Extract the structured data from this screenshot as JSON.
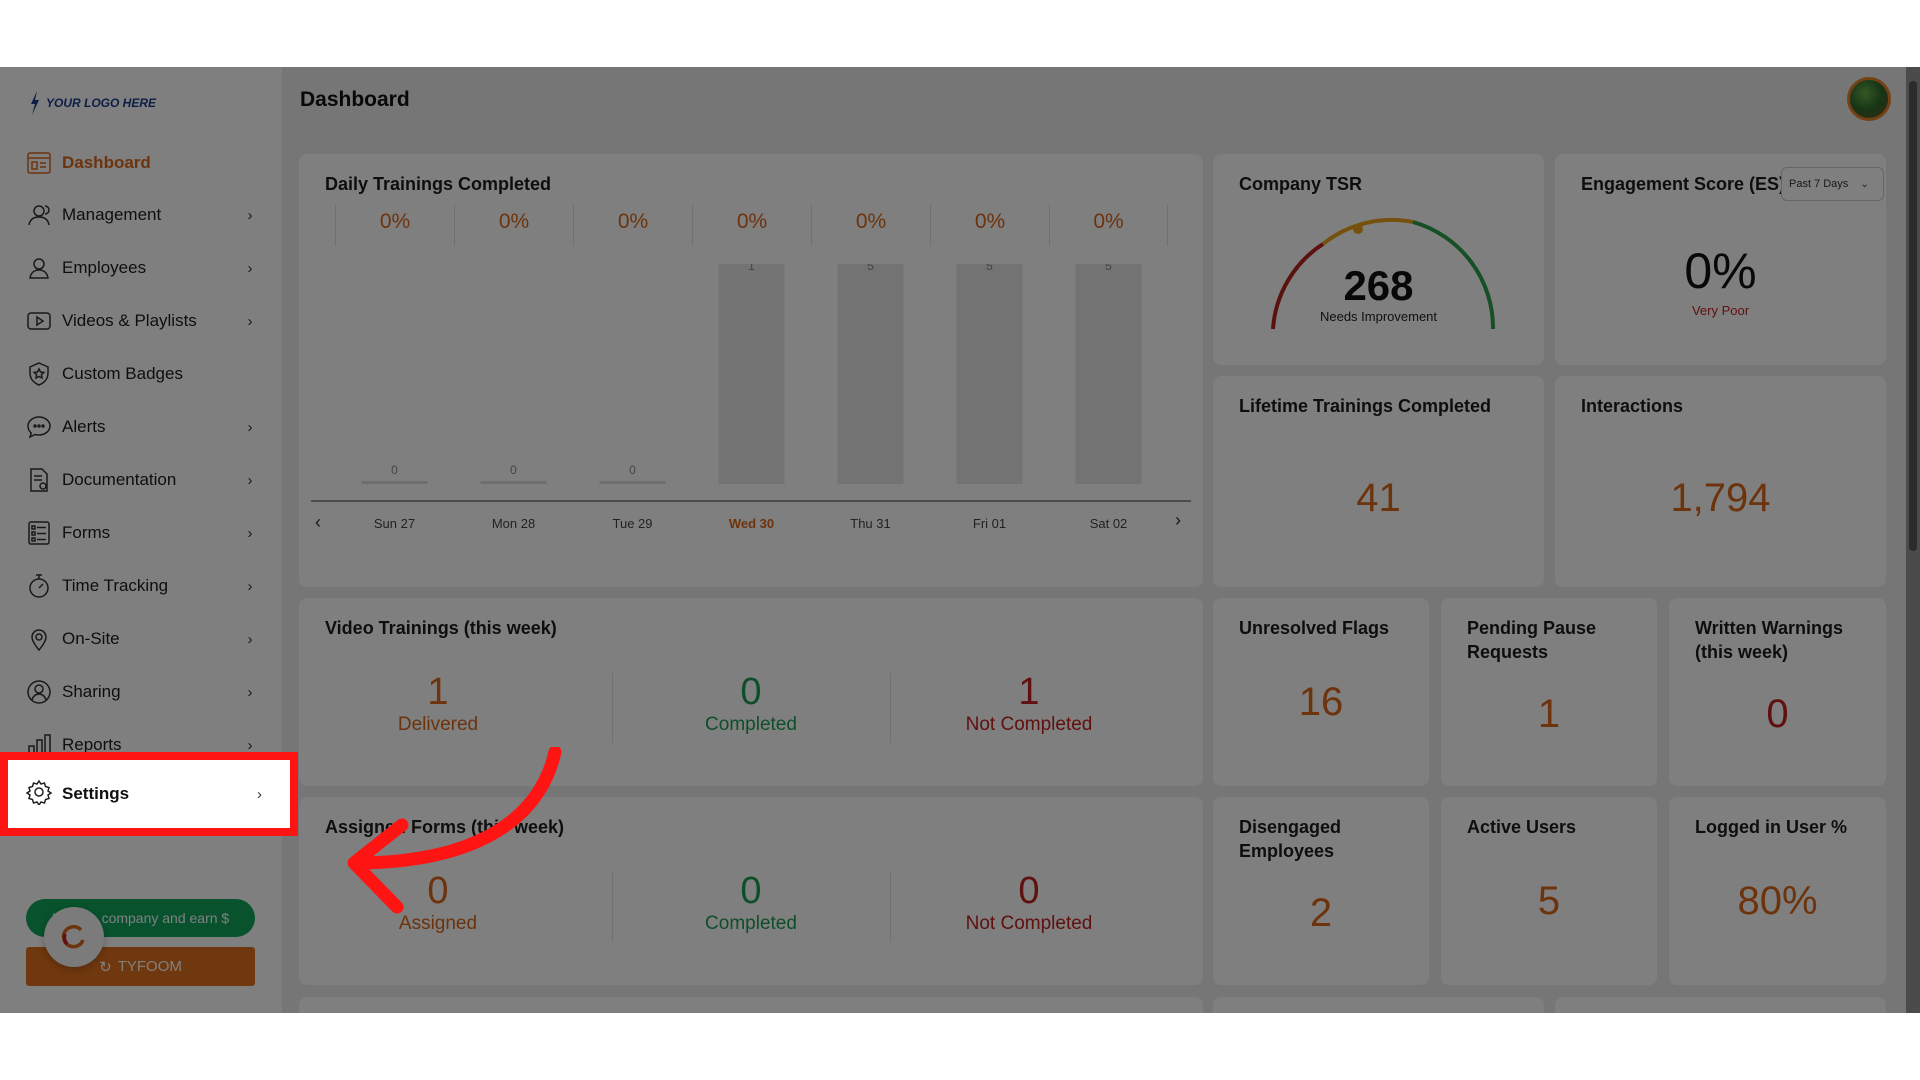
{
  "logo": {
    "text": "YOUR LOGO HERE"
  },
  "header": {
    "title": "Dashboard"
  },
  "sidebar": {
    "items": [
      {
        "label": "Dashboard",
        "icon": "dashboard-icon"
      },
      {
        "label": "Management",
        "icon": "users-icon"
      },
      {
        "label": "Employees",
        "icon": "user-icon"
      },
      {
        "label": "Videos & Playlists",
        "icon": "video-icon"
      },
      {
        "label": "Custom Badges",
        "icon": "badge-icon"
      },
      {
        "label": "Alerts",
        "icon": "chat-icon"
      },
      {
        "label": "Documentation",
        "icon": "document-icon"
      },
      {
        "label": "Forms",
        "icon": "list-icon"
      },
      {
        "label": "Time Tracking",
        "icon": "stopwatch-icon"
      },
      {
        "label": "On-Site",
        "icon": "location-icon"
      },
      {
        "label": "Sharing",
        "icon": "share-icon"
      },
      {
        "label": "Reports",
        "icon": "chart-icon"
      },
      {
        "label": "Settings",
        "icon": "gear-icon"
      }
    ],
    "refer_label": "Refer a company and earn $",
    "tyfoom_label": "TYFOOM"
  },
  "daily": {
    "title": "Daily Trainings Completed",
    "percents": [
      "0%",
      "0%",
      "0%",
      "0%",
      "0%",
      "0%",
      "0%"
    ],
    "days": [
      "Sun 27",
      "Mon 28",
      "Tue 29",
      "Wed 30",
      "Thu 31",
      "Fri 01",
      "Sat 02"
    ],
    "highlight_day": "Wed 30"
  },
  "chart_data": {
    "type": "bar",
    "title": "Daily Trainings Completed",
    "categories": [
      "Sun 27",
      "Mon 28",
      "Tue 29",
      "Wed 30",
      "Thu 31",
      "Fri 01",
      "Sat 02"
    ],
    "values": [
      0,
      0,
      0,
      1,
      5,
      5,
      5
    ],
    "ylim": [
      0,
      5
    ]
  },
  "tsr": {
    "title": "Company TSR",
    "value": "268",
    "status": "Needs Improvement"
  },
  "engagement": {
    "title": "Engagement Score (ES)",
    "value": "0%",
    "status": "Very Poor",
    "range": "Past 7 Days"
  },
  "lifetime": {
    "title": "Lifetime Trainings Completed",
    "value": "41"
  },
  "interactions": {
    "title": "Interactions",
    "value": "1,794"
  },
  "video": {
    "title": "Video Trainings (this week)",
    "stats": [
      {
        "value": "1",
        "label": "Delivered"
      },
      {
        "value": "0",
        "label": "Completed"
      },
      {
        "value": "1",
        "label": "Not Completed"
      }
    ]
  },
  "forms": {
    "title": "Assigned Forms (this week)",
    "stats": [
      {
        "value": "0",
        "label": "Assigned"
      },
      {
        "value": "0",
        "label": "Completed"
      },
      {
        "value": "0",
        "label": "Not Completed"
      }
    ]
  },
  "flags": {
    "title": "Unresolved Flags",
    "value": "16"
  },
  "pause": {
    "title": "Pending Pause Requests",
    "value": "1"
  },
  "warnings": {
    "title": "Written Warnings (this week)",
    "value": "0"
  },
  "disengaged": {
    "title": "Disengaged Employees",
    "value": "2"
  },
  "active": {
    "title": "Active Users",
    "value": "5"
  },
  "logged": {
    "title": "Logged in User %",
    "value": "80%"
  }
}
